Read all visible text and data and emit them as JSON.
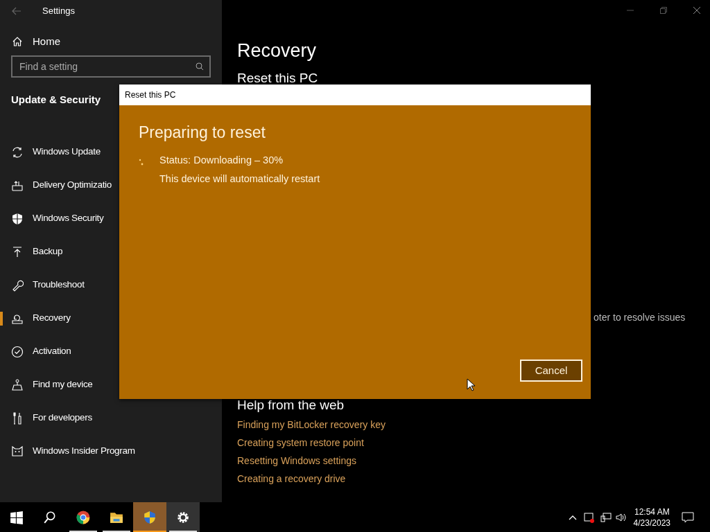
{
  "window": {
    "title": "Settings"
  },
  "sidebar": {
    "home": "Home",
    "search": {
      "placeholder": "Find a setting"
    },
    "section": "Update & Security",
    "items": [
      {
        "label": "Windows Update",
        "selected": false
      },
      {
        "label": "Delivery Optimizatio",
        "selected": false
      },
      {
        "label": "Windows Security",
        "selected": false
      },
      {
        "label": "Backup",
        "selected": false
      },
      {
        "label": "Troubleshoot",
        "selected": false
      },
      {
        "label": "Recovery",
        "selected": true
      },
      {
        "label": "Activation",
        "selected": false
      },
      {
        "label": "Find my device",
        "selected": false
      },
      {
        "label": "For developers",
        "selected": false
      },
      {
        "label": "Windows Insider Program",
        "selected": false
      }
    ]
  },
  "main": {
    "title": "Recovery",
    "section": "Reset this PC",
    "partial_text": "oter to resolve issues",
    "help_title": "Help from the web",
    "links": [
      "Finding my BitLocker recovery key",
      "Creating system restore point",
      "Resetting Windows settings",
      "Creating a recovery drive"
    ]
  },
  "dialog": {
    "title": "Reset this PC",
    "heading": "Preparing to reset",
    "status": "Status: Downloading – 30%",
    "note": "This device will automatically restart",
    "button": "Cancel"
  },
  "taskbar": {
    "apps": [
      {
        "kind": "start",
        "selected": false
      },
      {
        "kind": "search",
        "selected": false
      },
      {
        "kind": "chrome",
        "selected": false
      },
      {
        "kind": "folder",
        "selected": false
      },
      {
        "kind": "shield",
        "selected": true
      },
      {
        "kind": "gear",
        "selected": false
      }
    ],
    "time": "12:54 AM",
    "date": "4/23/2023"
  }
}
